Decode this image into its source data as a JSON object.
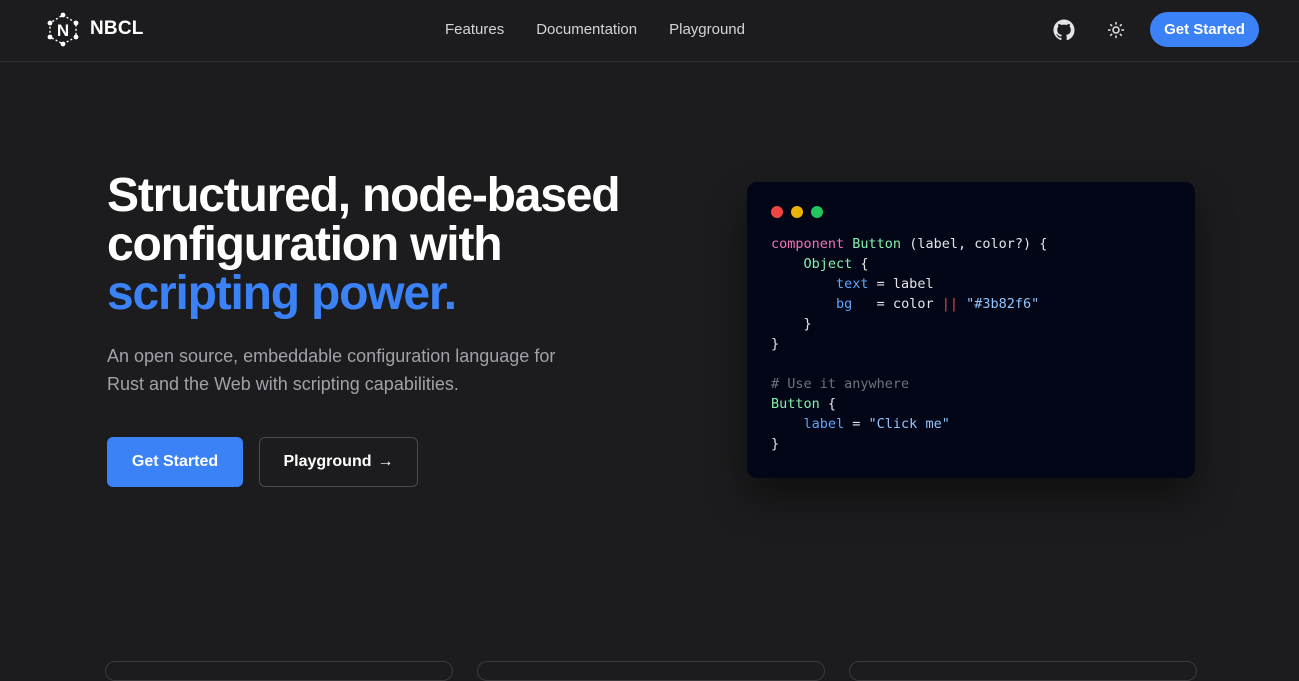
{
  "brand": {
    "name": "NBCL",
    "logo_icon": "nbcl-logo-icon"
  },
  "nav": {
    "links": [
      "Features",
      "Documentation",
      "Playground"
    ],
    "github_icon": "github-icon",
    "theme_icon": "sun-icon",
    "cta_label": "Get Started"
  },
  "hero": {
    "title_line1": "Structured, node-based",
    "title_line2": "configuration with",
    "title_accent": "scripting power.",
    "subtitle_line1": "An open source, embeddable configuration language for",
    "subtitle_line2": "Rust and the Web with scripting capabilities.",
    "primary_button": "Get Started",
    "secondary_button": "Playground",
    "secondary_arrow": "→"
  },
  "code": {
    "lines": [
      [
        [
          "kw",
          "component"
        ],
        [
          "plain",
          " "
        ],
        [
          "type",
          "Button"
        ],
        [
          "plain",
          " (label, color?) {"
        ]
      ],
      [
        [
          "plain",
          "    "
        ],
        [
          "type",
          "Object"
        ],
        [
          "plain",
          " {"
        ]
      ],
      [
        [
          "plain",
          "        "
        ],
        [
          "attr",
          "text"
        ],
        [
          "plain",
          " = label"
        ]
      ],
      [
        [
          "plain",
          "        "
        ],
        [
          "attr",
          "bg"
        ],
        [
          "plain",
          "   = color "
        ],
        [
          "op",
          "||"
        ],
        [
          "plain",
          " "
        ],
        [
          "str",
          "\"#3b82f6\""
        ]
      ],
      [
        [
          "plain",
          "    }"
        ]
      ],
      [
        [
          "plain",
          "}"
        ]
      ],
      [
        [
          "plain",
          ""
        ]
      ],
      [
        [
          "cmt",
          "# Use it anywhere"
        ]
      ],
      [
        [
          "type",
          "Button"
        ],
        [
          "plain",
          " {"
        ]
      ],
      [
        [
          "plain",
          "    "
        ],
        [
          "attr",
          "label"
        ],
        [
          "plain",
          " = "
        ],
        [
          "str",
          "\"Click me\""
        ]
      ],
      [
        [
          "plain",
          "}"
        ]
      ]
    ]
  },
  "colors": {
    "accent": "#3b82f6",
    "background": "#1c1c1e",
    "code_background": "#020617"
  }
}
